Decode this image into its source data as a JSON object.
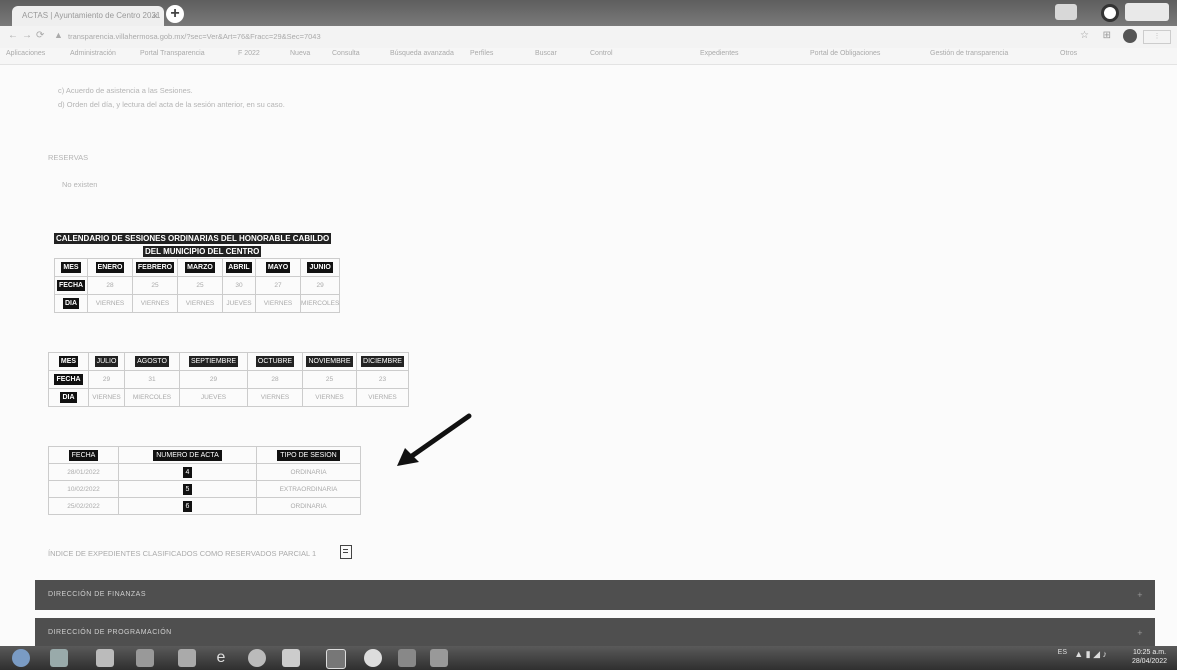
{
  "browser": {
    "tab_title": "ACTAS | Ayuntamiento de Centro 2021",
    "tab_close": "×",
    "new_tab": "+",
    "url": "transparencia.villahermosa.gob.mx/?sec=Ver&Art=76&Fracc=29&Sec=7043",
    "bookmarks": [
      "Aplicaciones",
      "Administración",
      "Portal Transparencia",
      "F 2022",
      "Nueva",
      "Consulta",
      "Búsqueda avanzada",
      "Perfiles",
      "Buscar",
      "Control",
      "Expedientes",
      "Portal de Obligaciones",
      "Gestión de transparencia",
      "Otros"
    ]
  },
  "page": {
    "intro_lines": [
      "c) Acuerdo de asistencia a las Sesiones.",
      "d) Orden del día, y lectura del acta de la sesión anterior, en su caso."
    ],
    "reservas_label": "RESERVAS",
    "reservas_value": "No existen",
    "calendar_title_1": "CALENDARIO DE SESIONES ORDINARIAS DEL HONORABLE CABILDO",
    "calendar_title_2": "DEL MUNICIPIO DEL CENTRO",
    "cal1": {
      "mes_label": "MES",
      "fecha_label": "FECHA",
      "dia_label": "DIA",
      "months": [
        "ENERO",
        "FEBRERO",
        "MARZO",
        "ABRIL",
        "MAYO",
        "JUNIO"
      ],
      "dates": [
        "28",
        "25",
        "25",
        "30",
        "27",
        "29"
      ],
      "days": [
        "VIERNES",
        "VIERNES",
        "VIERNES",
        "JUEVES",
        "VIERNES",
        "MIERCOLES"
      ]
    },
    "cal2": {
      "mes_label": "MES",
      "fecha_label": "FECHA",
      "dia_label": "DIA",
      "months": [
        "JULIO",
        "AGOSTO",
        "SEPTIEMBRE",
        "OCTUBRE",
        "NOVIEMBRE",
        "DICIEMBRE"
      ],
      "dates": [
        "29",
        "31",
        "29",
        "28",
        "25",
        "23"
      ],
      "days": [
        "VIERNES",
        "MIERCOLES",
        "JUEVES",
        "VIERNES",
        "VIERNES",
        "VIERNES"
      ]
    },
    "actas": {
      "headers": [
        "FECHA",
        "NUMERO DE ACTA",
        "TIPO DE SESION"
      ],
      "rows": [
        [
          "28/01/2022",
          "4",
          "ORDINARIA"
        ],
        [
          "10/02/2022",
          "5",
          "EXTRAORDINARIA"
        ],
        [
          "25/02/2022",
          "6",
          "ORDINARIA"
        ]
      ]
    },
    "indice_text": "ÍNDICE DE EXPEDIENTES CLASIFICADOS COMO RESERVADOS PARCIAL 1",
    "sections": [
      "DIRECCIÓN DE FINANZAS",
      "DIRECCIÓN DE PROGRAMACIÓN"
    ],
    "section_toggle": "+"
  },
  "taskbar": {
    "tray_lang": "ES",
    "clock_time": "10:25 a.m.",
    "clock_date": "28/04/2022"
  }
}
